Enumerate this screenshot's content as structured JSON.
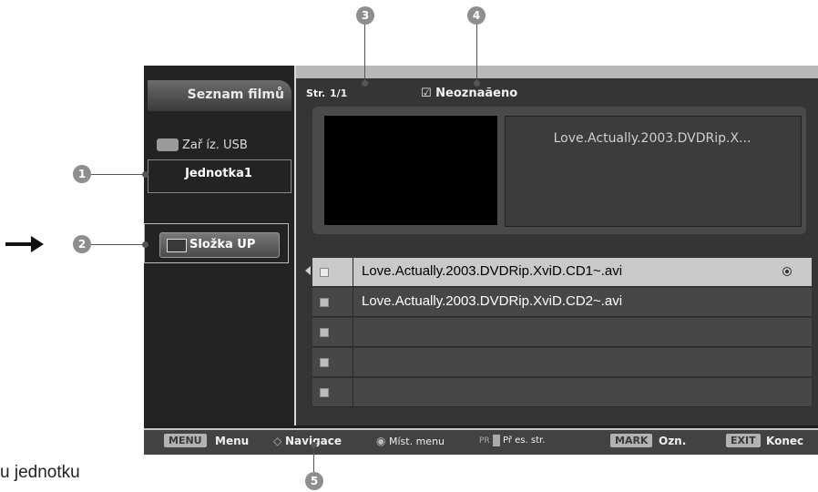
{
  "left_panel": {
    "title": "Seznam filmů",
    "usb_label": "Zař íz. USB",
    "drive_label": "Jednotka1",
    "folder_up_label": "Složka UP"
  },
  "header": {
    "page_label": "Str.",
    "page_value": "1/1",
    "unmarked_label": "☑ Neoznaãeno"
  },
  "preview": {
    "info_title": "Love.Actually.2003.DVDRip.X..."
  },
  "files": [
    {
      "name": "Love.Actually.2003.DVDRip.XviD.CD1~.avi",
      "selected": true
    },
    {
      "name": "Love.Actually.2003.DVDRip.XviD.CD2~.avi",
      "selected": false
    },
    {
      "name": "",
      "selected": false
    },
    {
      "name": "",
      "selected": false
    },
    {
      "name": "",
      "selected": false
    }
  ],
  "bottom_bar": {
    "menu_key": "MENU",
    "menu_label": "Menu",
    "nav_label": "Navigace",
    "context_label": "Míst. menu",
    "pr_label": "PR",
    "page_label": "Př es. str.",
    "mark_key": "MARK",
    "mark_label": "Ozn.",
    "exit_key": "EXIT",
    "exit_label": "Konec"
  },
  "callouts": {
    "c1": "1",
    "c2": "2",
    "c3": "3",
    "c4": "4",
    "c5": "5"
  },
  "side_text": "u jednotku",
  "colors": {
    "screen_bg": "#1e1e1e",
    "selected_row": "#c9c9c9",
    "row": "#474747"
  }
}
